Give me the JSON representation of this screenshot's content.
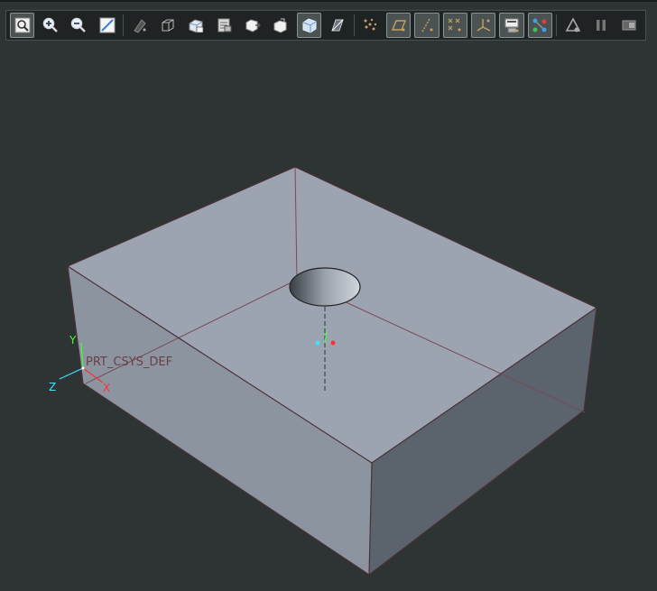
{
  "toolbar": {
    "buttons": [
      {
        "name": "refit-button",
        "icon": "refit-icon",
        "active": true
      },
      {
        "name": "zoom-in-button",
        "icon": "zoom-in-icon",
        "active": false
      },
      {
        "name": "zoom-out-button",
        "icon": "zoom-out-icon",
        "active": false
      },
      {
        "name": "repaint-button",
        "icon": "repaint-icon",
        "active": false
      },
      {
        "name": "display-style-button",
        "icon": "display-style-icon",
        "active": false
      },
      {
        "name": "saved-orientations-button",
        "icon": "saved-orientations-icon",
        "active": false
      },
      {
        "name": "named-views-button",
        "icon": "named-views-icon",
        "active": false
      },
      {
        "name": "view-manager-button",
        "icon": "view-manager-icon",
        "active": false
      },
      {
        "name": "reorient-button",
        "icon": "reorient-icon",
        "active": false
      },
      {
        "name": "standard-orientation-button",
        "icon": "standard-orientation-icon",
        "active": false
      },
      {
        "name": "shading-button",
        "icon": "shading-icon",
        "active": true
      },
      {
        "name": "perspective-button",
        "icon": "perspective-icon",
        "active": false
      },
      {
        "name": "spin-center-button",
        "icon": "spin-center-icon",
        "active": false
      },
      {
        "name": "plane-display-button",
        "icon": "plane-display-icon",
        "active": true
      },
      {
        "name": "axis-display-button",
        "icon": "axis-display-icon",
        "active": true
      },
      {
        "name": "point-display-button",
        "icon": "point-display-icon",
        "active": true
      },
      {
        "name": "csys-display-button",
        "icon": "csys-display-icon",
        "active": true
      },
      {
        "name": "annotation-display-button",
        "icon": "annotation-display-icon",
        "active": true
      },
      {
        "name": "network-display-button",
        "icon": "network-display-icon",
        "active": true
      },
      {
        "name": "simulation-display-button",
        "icon": "simulation-display-icon",
        "active": false
      },
      {
        "name": "pause-button",
        "icon": "pause-icon",
        "active": false
      },
      {
        "name": "view-exit-button",
        "icon": "view-exit-icon",
        "active": false
      }
    ]
  },
  "model": {
    "csys_label": "PRT_CSYS_DEF",
    "axis_x": "X",
    "axis_y": "Y",
    "axis_z": "Z"
  },
  "colors": {
    "background": "#2e3333",
    "top_face": "#9ba4b0",
    "front_face": "#8a929d",
    "right_face": "#5a626c",
    "edge": "#5a3a44",
    "datum_line": "#7a4a55",
    "x_axis": "#ff3030",
    "y_axis": "#40ff40",
    "z_axis": "#40e0ff"
  }
}
